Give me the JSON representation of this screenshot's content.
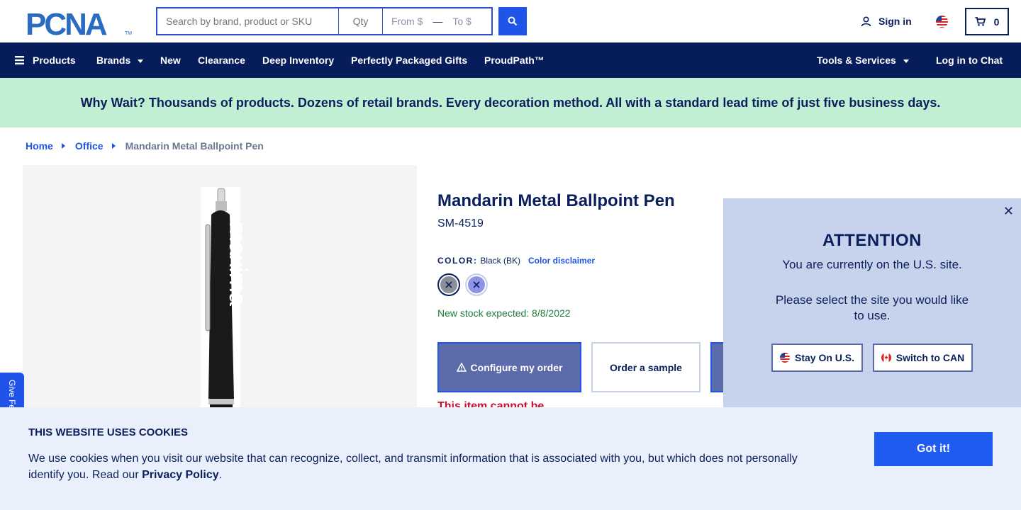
{
  "header": {
    "logo_text": "PCNA",
    "search_placeholder": "Search by brand, product or SKU",
    "qty_placeholder": "Qty",
    "from_placeholder": "From $",
    "to_placeholder": "To $",
    "signin_label": "Sign in",
    "cart_count": "0"
  },
  "nav": {
    "products": "Products",
    "brands": "Brands",
    "new": "New",
    "clearance": "Clearance",
    "deep_inventory": "Deep Inventory",
    "gifts": "Perfectly Packaged Gifts",
    "proudpath": "ProudPath™",
    "tools": "Tools & Services",
    "chat": "Log in to Chat"
  },
  "promo": {
    "text": "Why Wait? Thousands of products. Dozens of retail brands. Every decoration method. All with a standard lead time of just five business days."
  },
  "breadcrumb": {
    "home": "Home",
    "office": "Office",
    "current": "Mandarin Metal Ballpoint Pen"
  },
  "product": {
    "image_text": "maxima",
    "title": "Mandarin Metal Ballpoint Pen",
    "sku": "SM-4519",
    "color_label": "COLOR:",
    "color_value": "Black (BK)",
    "color_disclaimer": "Color disclaimer",
    "stock_text": "New stock expected: 8/8/2022",
    "configure_label": "Configure my order",
    "sample_label": "Order a sample",
    "warning_text": "This item cannot be"
  },
  "attention": {
    "title": "ATTENTION",
    "line1": "You are currently on the U.S. site.",
    "line2": "Please select the site you would like to use.",
    "stay_label": "Stay On U.S.",
    "switch_label": "Switch to CAN"
  },
  "feedback": {
    "label": "Give Feedback"
  },
  "cookie": {
    "title": "THIS WEBSITE USES COOKIES",
    "text": "We use cookies when you visit our website that can recognize, collect, and transmit information that is associated with you, but which does not personally identify you. Read our ",
    "link": "Privacy Policy",
    "end": ".",
    "button": "Got it!"
  },
  "colors": {
    "navy": "#071c5b",
    "accent_blue": "#2053e7",
    "promo_green": "#c0efd4",
    "modal_bg": "#c7d3ed",
    "cookie_bg": "#e9f0fb"
  }
}
